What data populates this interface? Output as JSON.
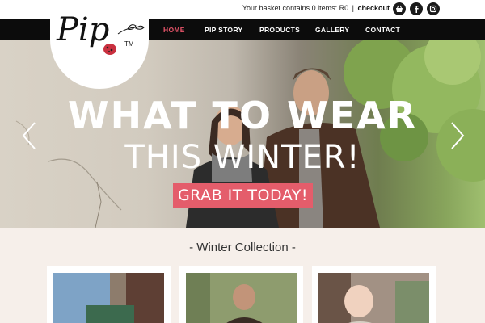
{
  "topbar": {
    "basket_text": "Your basket contains 0 items: R0",
    "separator": "|",
    "checkout_label": "checkout",
    "social_icons": [
      "shopping-basket-icon",
      "facebook-icon",
      "instagram-icon"
    ]
  },
  "logo": {
    "text": "Pip",
    "trademark": "TM"
  },
  "nav": {
    "items": [
      {
        "label": "HOME",
        "active": true
      },
      {
        "label": "PIP STORY",
        "active": false
      },
      {
        "label": "PRODUCTS",
        "active": false
      },
      {
        "label": "GALLERY",
        "active": false
      },
      {
        "label": "CONTACT",
        "active": false
      }
    ]
  },
  "hero": {
    "line1": "WHAT TO WEAR",
    "line2": "THIS WINTER!",
    "cta_label": "GRAB IT TODAY!",
    "prev_icon": "chevron-left-icon",
    "next_icon": "chevron-right-icon"
  },
  "collection": {
    "title": "- Winter Collection -",
    "cards": [
      {
        "name": "card-1"
      },
      {
        "name": "card-2"
      },
      {
        "name": "card-3"
      }
    ]
  },
  "colors": {
    "accent": "#e8556a",
    "cta": "#e45d6b",
    "navbar": "#0c0c0c",
    "page": "#f6efea"
  }
}
